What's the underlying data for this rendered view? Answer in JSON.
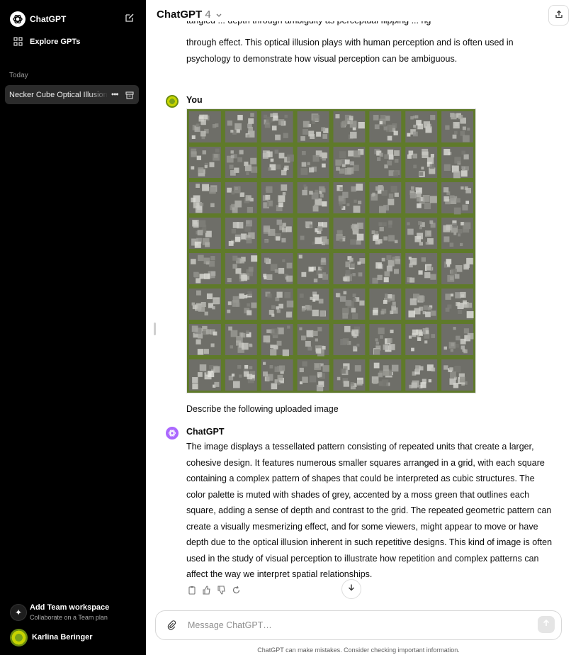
{
  "sidebar": {
    "brand": "ChatGPT",
    "explore": "Explore GPTs",
    "section_today": "Today",
    "chat_item": "Necker Cube Optical Illusion",
    "team_title": "Add Team workspace",
    "team_sub": "Collaborate on a Team plan",
    "user_name": "Karlina Beringer"
  },
  "header": {
    "title": "ChatGPT",
    "version": "4"
  },
  "conversation": {
    "prev_partial_line": "through effect. This optical illusion plays with human perception and is often used in",
    "prev_line_last": "psychology to demonstrate how visual perception can be ambiguous.",
    "user_name": "You",
    "user_prompt": "Describe the following uploaded image",
    "assistant_name": "ChatGPT",
    "assistant_reply": "The image displays a tessellated pattern consisting of repeated units that create a larger, cohesive design. It features numerous smaller squares arranged in a grid, with each square containing a complex pattern of shapes that could be interpreted as cubic structures. The color palette is muted with shades of grey, accented by a moss green that outlines each square, adding a sense of depth and contrast to the grid. The repeated geometric pattern can create a visually mesmerizing effect, and for some viewers, might appear to move or have depth due to the optical illusion inherent in such repetitive designs. This kind of image is often used in the study of visual perception to illustrate how repetition and complex patterns can affect the way we interpret spatial relationships."
  },
  "composer": {
    "placeholder": "Message ChatGPT…"
  },
  "footer": {
    "disclaimer": "ChatGPT can make mistakes. Consider checking important information."
  },
  "colors": {
    "sidebar_bg": "#000000",
    "tile_grey": "#6e6e68",
    "tile_green": "#5f7a2a",
    "gpt_avatar": "#ab68ff"
  }
}
